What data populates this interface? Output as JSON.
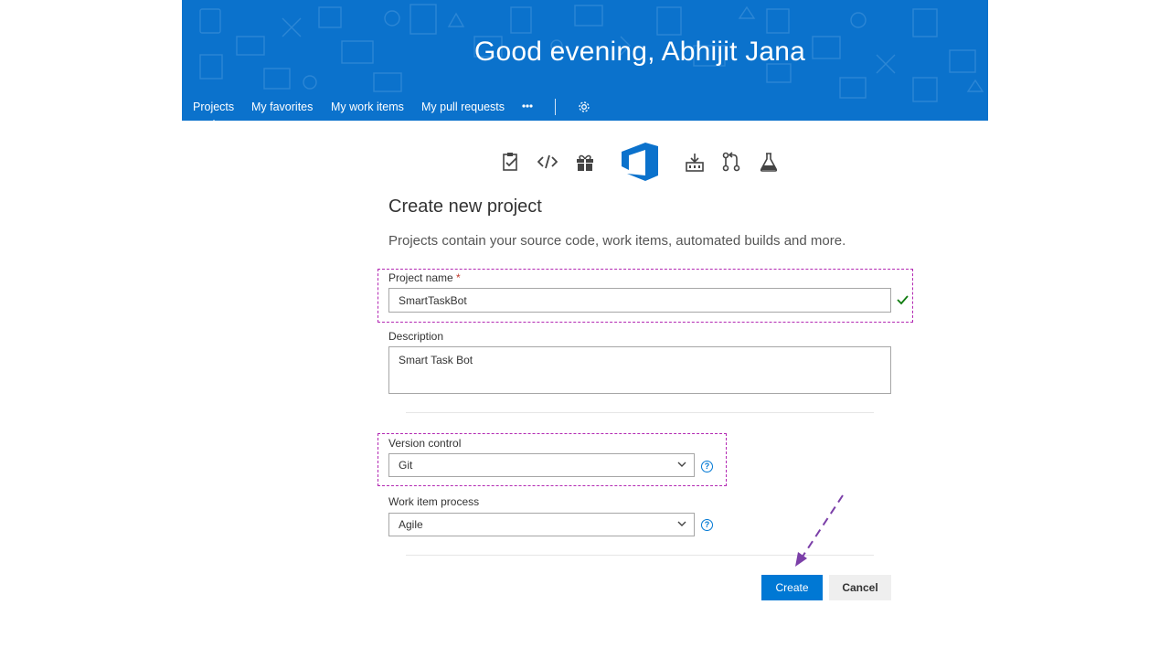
{
  "header": {
    "greeting": "Good evening, Abhijit Jana",
    "nav": [
      {
        "label": "Projects",
        "active": true
      },
      {
        "label": "My favorites"
      },
      {
        "label": "My work items"
      },
      {
        "label": "My pull requests"
      }
    ],
    "more_icon": "ellipsis-icon",
    "settings_icon": "gear-icon",
    "brand_color": "#0b72cc"
  },
  "hub_icons": [
    "boards-icon",
    "code-icon",
    "gift-icon",
    "azure-devops-logo",
    "build-icon",
    "pull-request-icon",
    "test-flask-icon"
  ],
  "form": {
    "title": "Create new project",
    "subtitle": "Projects contain your source code, work items, automated builds and more.",
    "project_name": {
      "label": "Project name",
      "required_mark": "*",
      "value": "SmartTaskBot",
      "valid": true
    },
    "description": {
      "label": "Description",
      "value": "Smart Task Bot"
    },
    "version_control": {
      "label": "Version control",
      "value": "Git"
    },
    "work_item_process": {
      "label": "Work item process",
      "value": "Agile"
    },
    "create_label": "Create",
    "cancel_label": "Cancel",
    "accent_color": "#0078d4",
    "highlight_color": "#b329b3"
  }
}
